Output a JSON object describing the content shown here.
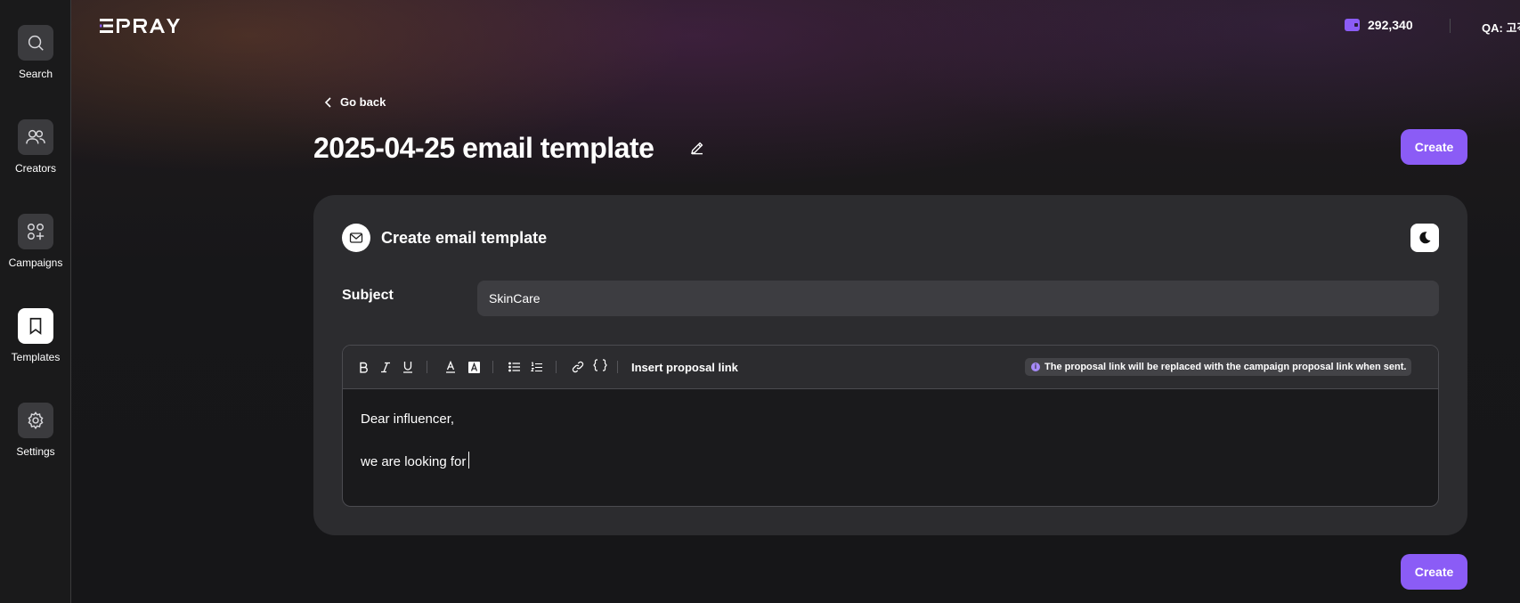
{
  "brand": {
    "logo_text": "EPRAY",
    "accent": "#8b5cf6"
  },
  "sidebar": {
    "items": [
      {
        "label": "Search",
        "icon": "search-icon",
        "active": false
      },
      {
        "label": "Creators",
        "icon": "users-icon",
        "active": false
      },
      {
        "label": "Campaigns",
        "icon": "campaigns-icon",
        "active": false
      },
      {
        "label": "Templates",
        "icon": "bookmark-icon",
        "active": true
      },
      {
        "label": "Settings",
        "icon": "gear-icon",
        "active": false
      }
    ]
  },
  "header": {
    "balance": "292,340",
    "user": "QA: 고객"
  },
  "page": {
    "go_back": "Go back",
    "title": "2025-04-25 email template",
    "create_label": "Create"
  },
  "card": {
    "title": "Create email template",
    "subject_label": "Subject",
    "subject_value": "SkinCare",
    "toolbar": {
      "insert_link": "Insert proposal link",
      "notice": "The proposal link will be replaced with the campaign proposal link when sent.",
      "notice_icon_glyph": "i"
    },
    "body_lines": [
      "Dear influencer,",
      "we are looking for"
    ]
  }
}
